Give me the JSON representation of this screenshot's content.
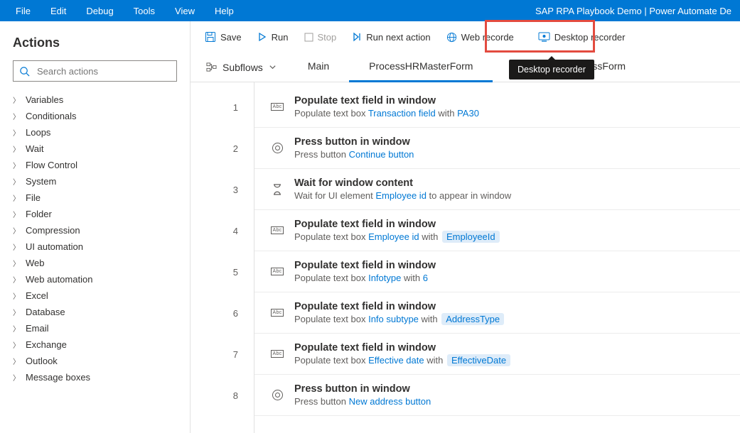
{
  "window_title": "SAP RPA Playbook Demo | Power Automate De",
  "menu": [
    "File",
    "Edit",
    "Debug",
    "Tools",
    "View",
    "Help"
  ],
  "sidebar": {
    "title": "Actions",
    "search_placeholder": "Search actions",
    "categories": [
      "Variables",
      "Conditionals",
      "Loops",
      "Wait",
      "Flow Control",
      "System",
      "File",
      "Folder",
      "Compression",
      "UI automation",
      "Web",
      "Web automation",
      "Excel",
      "Database",
      "Email",
      "Exchange",
      "Outlook",
      "Message boxes"
    ]
  },
  "toolbar": {
    "save": "Save",
    "run": "Run",
    "stop": "Stop",
    "run_next": "Run next action",
    "web_rec": "Web recorde",
    "desk_rec": "Desktop recorder"
  },
  "tooltip": "Desktop recorder",
  "subflows_label": "Subflows",
  "tabs": [
    {
      "label": "Main",
      "active": false
    },
    {
      "label": "ProcessHRMasterForm",
      "active": true
    },
    {
      "label": "ssForm",
      "active": false,
      "partial": true
    }
  ],
  "steps": [
    {
      "n": 1,
      "icon": "abc",
      "title": "Populate text field in window",
      "desc": [
        {
          "t": "Populate text box "
        },
        {
          "t": "Transaction field",
          "link": true
        },
        {
          "t": " with "
        },
        {
          "t": "PA30",
          "link": true
        }
      ]
    },
    {
      "n": 2,
      "icon": "press",
      "title": "Press button in window",
      "desc": [
        {
          "t": "Press button "
        },
        {
          "t": "Continue button",
          "link": true
        }
      ]
    },
    {
      "n": 3,
      "icon": "wait",
      "title": "Wait for window content",
      "desc": [
        {
          "t": "Wait for UI element "
        },
        {
          "t": "Employee id",
          "link": true
        },
        {
          "t": " to appear in window"
        }
      ]
    },
    {
      "n": 4,
      "icon": "abc",
      "title": "Populate text field in window",
      "desc": [
        {
          "t": "Populate text box "
        },
        {
          "t": "Employee id",
          "link": true
        },
        {
          "t": " with "
        },
        {
          "t": "EmployeeId",
          "pill": true
        }
      ]
    },
    {
      "n": 5,
      "icon": "abc",
      "title": "Populate text field in window",
      "desc": [
        {
          "t": "Populate text box "
        },
        {
          "t": "Infotype",
          "link": true
        },
        {
          "t": " with "
        },
        {
          "t": "6",
          "link": true
        }
      ]
    },
    {
      "n": 6,
      "icon": "abc",
      "title": "Populate text field in window",
      "desc": [
        {
          "t": "Populate text box "
        },
        {
          "t": "Info subtype",
          "link": true
        },
        {
          "t": " with "
        },
        {
          "t": "AddressType",
          "pill": true
        }
      ]
    },
    {
      "n": 7,
      "icon": "abc",
      "title": "Populate text field in window",
      "desc": [
        {
          "t": "Populate text box "
        },
        {
          "t": "Effective date",
          "link": true
        },
        {
          "t": " with "
        },
        {
          "t": "EffectiveDate",
          "pill": true
        }
      ]
    },
    {
      "n": 8,
      "icon": "press",
      "title": "Press button in window",
      "desc": [
        {
          "t": "Press button "
        },
        {
          "t": "New address button",
          "link": true
        }
      ]
    }
  ]
}
